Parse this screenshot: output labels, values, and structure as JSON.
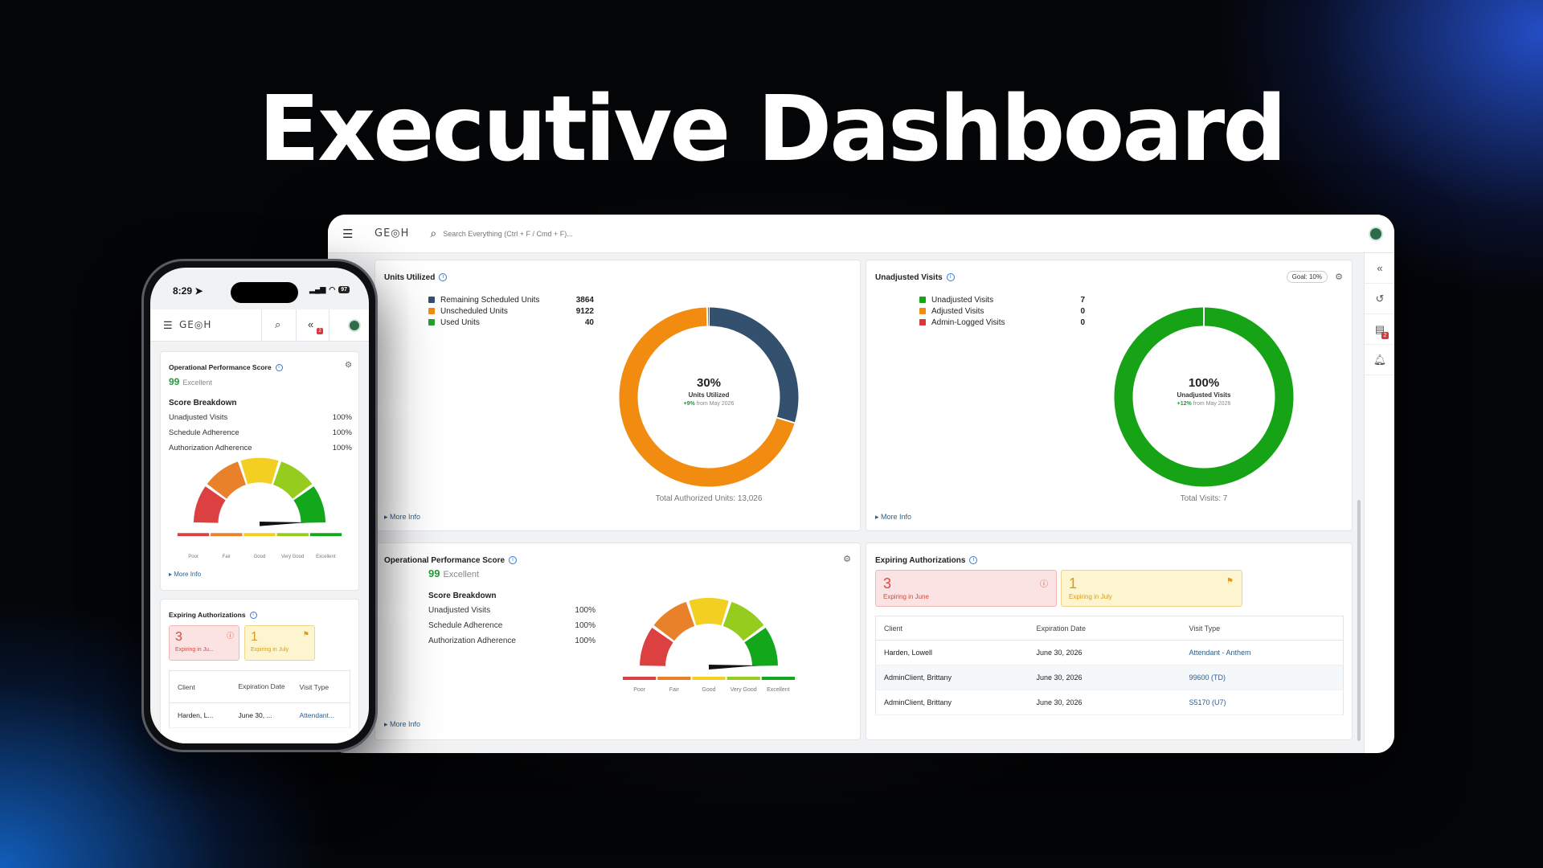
{
  "headline": "Executive Dashboard",
  "app": {
    "logo": "GE◎H",
    "search_placeholder": "Search Everything (Ctrl + F / Cmd + F)...",
    "notification_count": "2"
  },
  "units_utilized": {
    "title": "Units Utilized",
    "legend": [
      {
        "label": "Remaining Scheduled Units",
        "value": "3864",
        "color": "#34506f"
      },
      {
        "label": "Unscheduled Units",
        "value": "9122",
        "color": "#f28c10"
      },
      {
        "label": "Used Units",
        "value": "40",
        "color": "#23a12e"
      }
    ],
    "center_pct": "30%",
    "center_label": "Units Utilized",
    "change": "+9%",
    "change_suffix": " from May 2026",
    "total": "Total Authorized Units: 13,026",
    "more": "More Info"
  },
  "unadjusted_visits": {
    "title": "Unadjusted Visits",
    "goal": "Goal: 10%",
    "legend": [
      {
        "label": "Unadjusted Visits",
        "value": "7",
        "color": "#16a316"
      },
      {
        "label": "Adjusted Visits",
        "value": "0",
        "color": "#f28c10"
      },
      {
        "label": "Admin-Logged Visits",
        "value": "0",
        "color": "#d9383a"
      }
    ],
    "center_pct": "100%",
    "center_label": "Unadjusted Visits",
    "change": "+12%",
    "change_suffix": " from May 2026",
    "total": "Total Visits: 7",
    "more": "More Info"
  },
  "ops_score": {
    "title": "Operational Performance Score",
    "score": "99",
    "score_word": "Excellent",
    "breakdown_title": "Score Breakdown",
    "breakdown": [
      {
        "label": "Unadjusted Visits",
        "value": "100%"
      },
      {
        "label": "Schedule Adherence",
        "value": "100%"
      },
      {
        "label": "Authorization Adherence",
        "value": "100%"
      }
    ],
    "gauge_labels": [
      "Poor",
      "Fair",
      "Good",
      "Very Good",
      "Excellent"
    ],
    "more": "More Info"
  },
  "expiring": {
    "title": "Expiring Authorizations",
    "june_count": "3",
    "june_label": "Expiring in June",
    "july_count": "1",
    "july_label": "Expiring in July",
    "columns": [
      "Client",
      "Expiration Date",
      "Visit Type"
    ],
    "rows": [
      {
        "client": "Harden, Lowell",
        "date": "June 30, 2026",
        "type": "Attendant - Anthem"
      },
      {
        "client": "AdminClient, Brittany",
        "date": "June 30, 2026",
        "type": "99600 (TD)"
      },
      {
        "client": "AdminClient, Brittany",
        "date": "June 30, 2026",
        "type": "S5170 (U7)"
      }
    ]
  },
  "phone": {
    "time": "8:29",
    "battery": "97",
    "june_label_short": "Expiring in Ju...",
    "col_expiration": "Expiration Date",
    "row_client": "Harden, L...",
    "row_date": "June 30, ...",
    "row_type": "Attendant..."
  }
}
